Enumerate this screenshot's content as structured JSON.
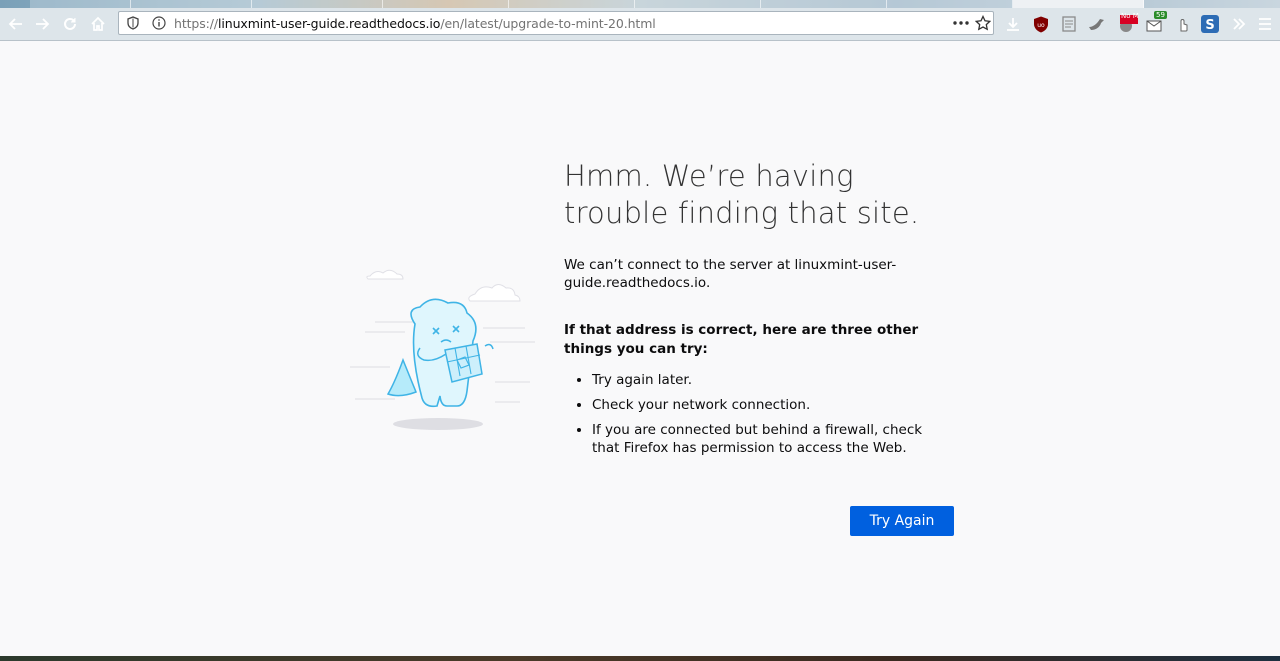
{
  "browser": {
    "url_host": "linuxmint-user-guide.readthedocs.io",
    "url_prefix": "https://",
    "url_path": "/en/latest/upgrade-to-mint-20.html",
    "badge_nomore": "No M",
    "badge_mail_count": "59"
  },
  "error": {
    "title": "Hmm. We’re having trouble finding that site.",
    "description": "We can’t connect to the server at linuxmint-user-guide.readthedocs.io.",
    "subtitle": "If that address is correct, here are three other things you can try:",
    "tips": [
      "Try again later.",
      "Check your network connection.",
      "If you are connected but behind a firewall, check that Firefox has permission to access the Web."
    ],
    "try_again_label": "Try Again"
  },
  "colors": {
    "accent": "#0060df",
    "toolbar": "#dde5ea",
    "page_bg": "#f9f9fa"
  }
}
